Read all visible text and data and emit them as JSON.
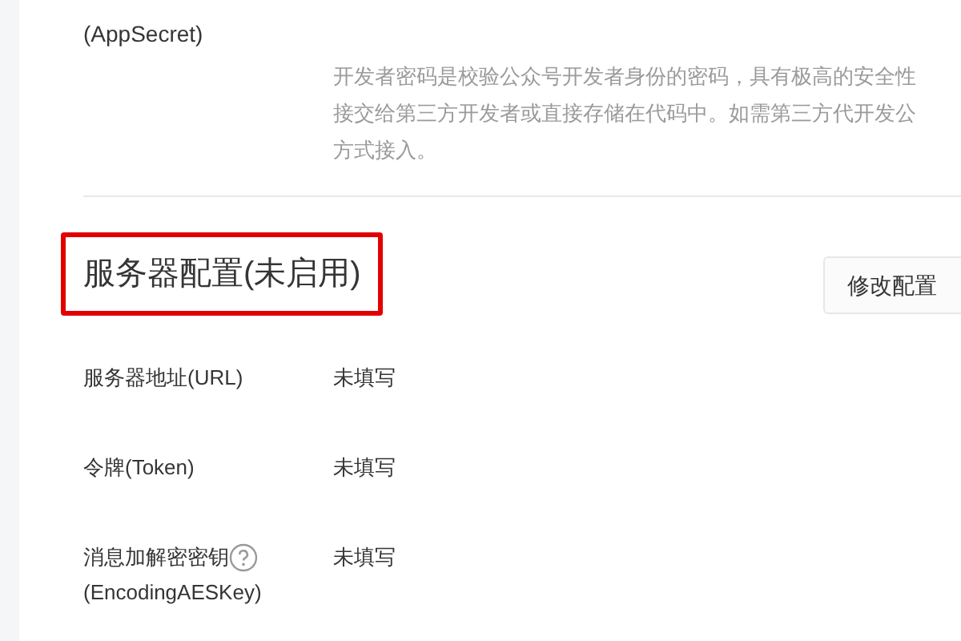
{
  "app_secret": {
    "label_lines": [
      "(AppSecret)"
    ],
    "description_lines": [
      "开发者密码是校验公众号开发者身份的密码，具有极高的安全性",
      "接交给第三方开发者或直接存储在代码中。如需第三方代开发公",
      "方式接入。"
    ]
  },
  "server_config": {
    "title": "服务器配置(未启用)",
    "edit_button": "修改配置",
    "fields": [
      {
        "label_lines": [
          "服务器地址(URL)"
        ],
        "help": false,
        "value": "未填写"
      },
      {
        "label_lines": [
          "令牌(Token)"
        ],
        "help": false,
        "value": "未填写"
      },
      {
        "label_lines": [
          "消息加解密密钥",
          "(EncodingAESKey)"
        ],
        "help": true,
        "value": "未填写"
      }
    ]
  }
}
